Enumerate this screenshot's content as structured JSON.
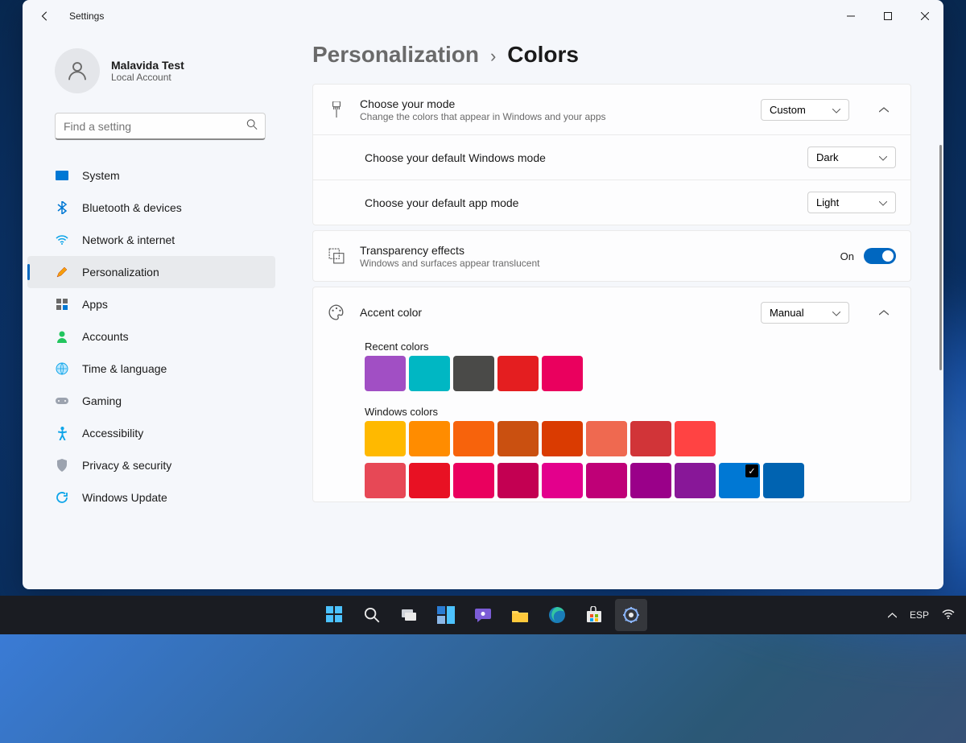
{
  "window_title": "Settings",
  "profile": {
    "name": "Malavida Test",
    "sub": "Local Account"
  },
  "search": {
    "placeholder": "Find a setting"
  },
  "sidebar": {
    "items": [
      {
        "label": "System"
      },
      {
        "label": "Bluetooth & devices"
      },
      {
        "label": "Network & internet"
      },
      {
        "label": "Personalization"
      },
      {
        "label": "Apps"
      },
      {
        "label": "Accounts"
      },
      {
        "label": "Time & language"
      },
      {
        "label": "Gaming"
      },
      {
        "label": "Accessibility"
      },
      {
        "label": "Privacy & security"
      },
      {
        "label": "Windows Update"
      }
    ]
  },
  "breadcrumb": {
    "parent": "Personalization",
    "sep": "›",
    "current": "Colors"
  },
  "mode": {
    "title": "Choose your mode",
    "desc": "Change the colors that appear in Windows and your apps",
    "value": "Custom",
    "win_mode_label": "Choose your default Windows mode",
    "win_mode_value": "Dark",
    "app_mode_label": "Choose your default app mode",
    "app_mode_value": "Light"
  },
  "transparency": {
    "title": "Transparency effects",
    "desc": "Windows and surfaces appear translucent",
    "state": "On"
  },
  "accent": {
    "title": "Accent color",
    "value": "Manual",
    "recent_label": "Recent colors",
    "recent": [
      "#a14fc4",
      "#00b7c3",
      "#4a4a48",
      "#e41e20",
      "#ea005e"
    ],
    "windows_label": "Windows colors",
    "windows": [
      "#ffb900",
      "#ff8c00",
      "#f7630c",
      "#ca5010",
      "#da3b01",
      "#ef6950",
      "#d13438",
      "#ff4343",
      "#e74856",
      "#e81123",
      "#ea005e",
      "#c30052",
      "#e3008c",
      "#bf0077",
      "#9a0089",
      "#881798",
      "#0078d4",
      "#0063b1"
    ],
    "selected_index": 16
  },
  "tray": {
    "lang": "ESP"
  }
}
